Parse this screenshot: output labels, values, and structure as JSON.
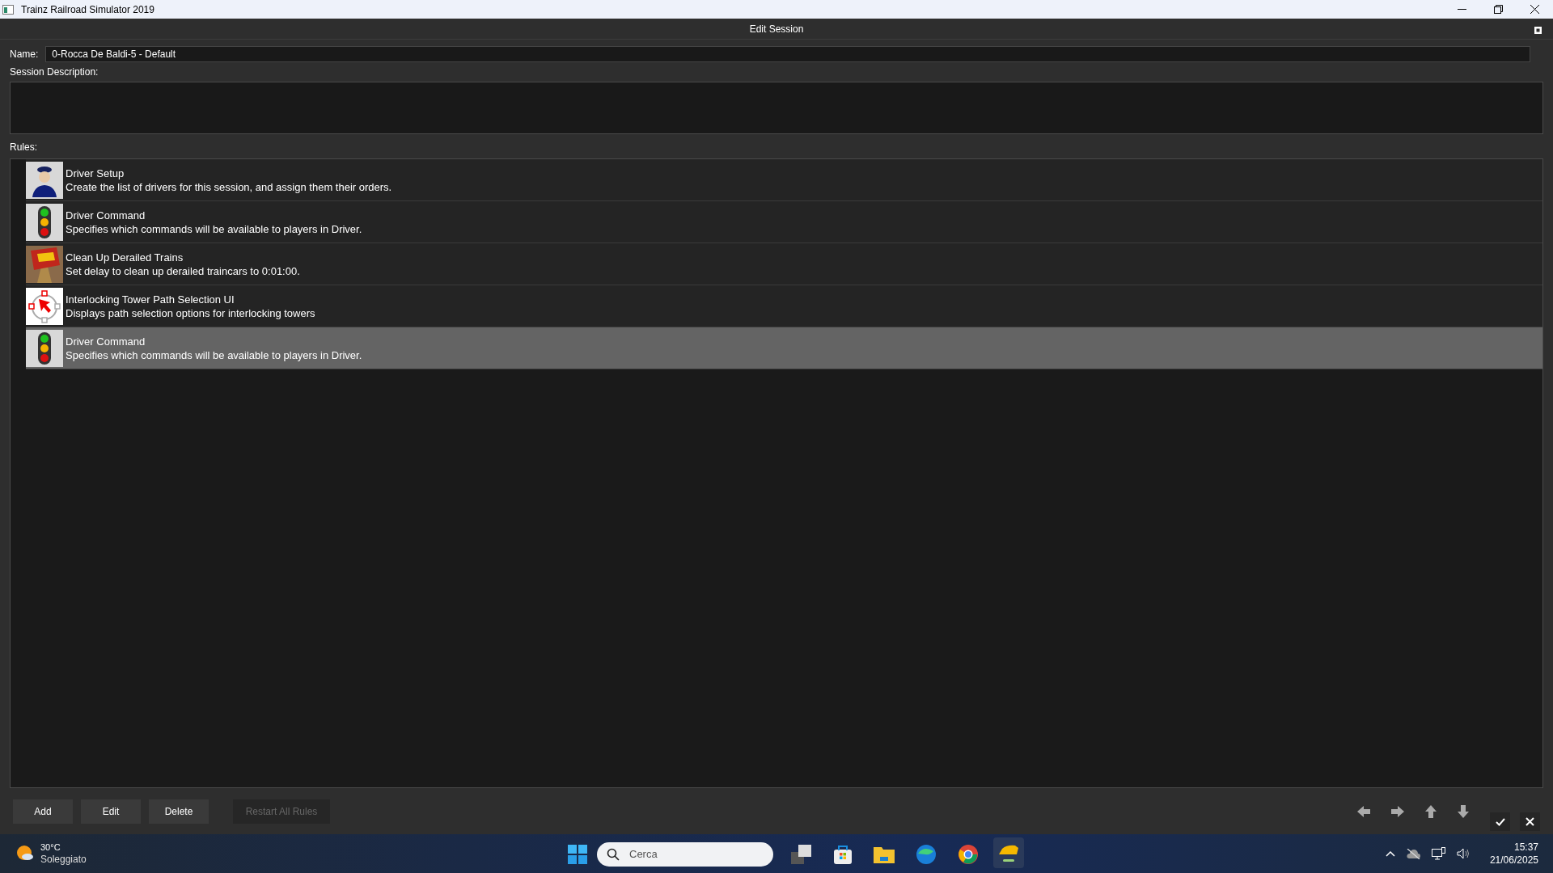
{
  "window": {
    "title": "Trainz Railroad Simulator 2019"
  },
  "dialog": {
    "title": "Edit Session"
  },
  "name_field": {
    "label": "Name:",
    "value": "0-Rocca De Baldi-5 - Default"
  },
  "description": {
    "label": "Session Description:"
  },
  "rules": {
    "label": "Rules:",
    "items": [
      {
        "kind": "driver",
        "title": "Driver Setup",
        "description": "Create the list of drivers for this session, and assign them their orders.",
        "selected": false
      },
      {
        "kind": "signal",
        "title": "Driver Command",
        "description": "Specifies which commands will be available to players in Driver.",
        "selected": false
      },
      {
        "kind": "derail",
        "title": "Clean Up Derailed Trains",
        "description": "Set delay to clean up derailed traincars to 0:01:00.",
        "selected": false
      },
      {
        "kind": "interlocking",
        "title": "Interlocking Tower Path Selection UI",
        "description": "Displays path selection options for interlocking towers",
        "selected": false
      },
      {
        "kind": "signal",
        "title": "Driver Command",
        "description": "Specifies which commands will be available to players in Driver.",
        "selected": true
      }
    ]
  },
  "buttons": [
    {
      "label": "Add",
      "disabled": false
    },
    {
      "label": "Edit",
      "disabled": false
    },
    {
      "label": "Delete",
      "disabled": false
    },
    {
      "label": "Restart All Rules",
      "disabled": true
    }
  ],
  "taskbar": {
    "weather": {
      "temperature": "30°C",
      "condition": "Soleggiato"
    },
    "search": {
      "placeholder": "Cerca"
    },
    "time": "15:37",
    "date": "21/06/2025"
  }
}
